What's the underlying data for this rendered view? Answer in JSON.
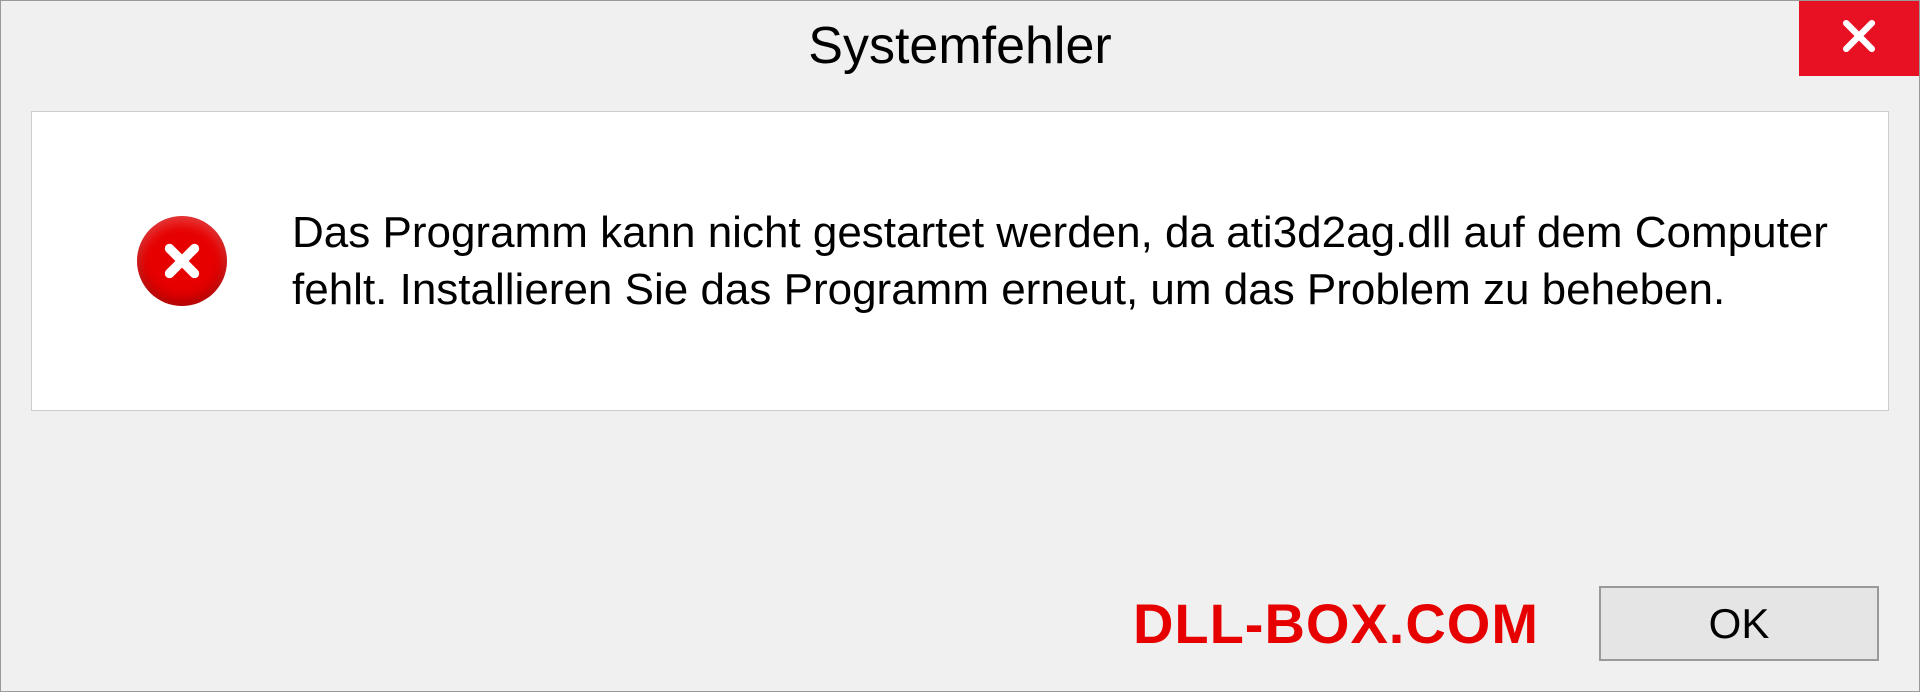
{
  "dialog": {
    "title": "Systemfehler",
    "message": "Das Programm kann nicht gestartet werden, da ati3d2ag.dll auf dem Computer fehlt. Installieren Sie das Programm erneut, um das Problem zu beheben.",
    "ok_label": "OK"
  },
  "watermark": "DLL-BOX.COM",
  "colors": {
    "close_bg": "#e81123",
    "error_red": "#e60000"
  }
}
